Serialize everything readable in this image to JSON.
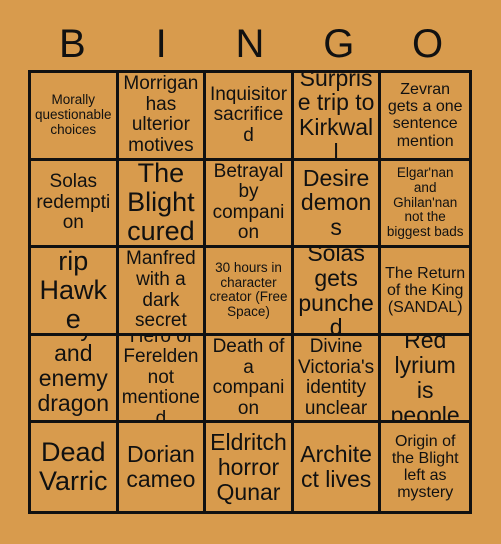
{
  "card": {
    "background_color": "#d89b4d",
    "ink_color": "#111111",
    "header_letters": [
      "B",
      "I",
      "N",
      "G",
      "O"
    ],
    "rows": [
      [
        {
          "text": "Morally questionable choices",
          "size": "xs"
        },
        {
          "text": "Morrigan has ulterior motives",
          "size": "md"
        },
        {
          "text": "Inquisitor sacrificed",
          "size": "md"
        },
        {
          "text": "Surprise trip to Kirkwall",
          "size": "lg"
        },
        {
          "text": "Zevran gets a one sentence mention",
          "size": "sm"
        }
      ],
      [
        {
          "text": "Solas redemption",
          "size": "md"
        },
        {
          "text": "The Blight cured",
          "size": "xl"
        },
        {
          "text": "Betrayal by companion",
          "size": "md"
        },
        {
          "text": "Desire demons",
          "size": "lg"
        },
        {
          "text": "Elgar'nan and Ghilan'nan not the biggest bads",
          "size": "xs"
        }
      ],
      [
        {
          "text": "rip Hawke",
          "size": "xl"
        },
        {
          "text": "Manfred with a dark secret",
          "size": "md"
        },
        {
          "text": "30 hours in character creator (Free Space)",
          "size": "xs"
        },
        {
          "text": "Solas gets punched",
          "size": "lg"
        },
        {
          "text": "The Return of the King (SANDAL)",
          "size": "sm"
        }
      ],
      [
        {
          "text": "Ally and enemy dragons",
          "size": "lg"
        },
        {
          "text": "Hero of Ferelden not mentioned",
          "size": "md"
        },
        {
          "text": "Death of a companion",
          "size": "md"
        },
        {
          "text": "Divine Victoria's identity unclear",
          "size": "md"
        },
        {
          "text": "Red lyrium is people",
          "size": "lg"
        }
      ],
      [
        {
          "text": "Dead Varric",
          "size": "xl"
        },
        {
          "text": "Dorian cameo",
          "size": "lg"
        },
        {
          "text": "Eldritch horror Qunar",
          "size": "lg"
        },
        {
          "text": "Architect lives",
          "size": "lg"
        },
        {
          "text": "Origin of the Blight left as mystery",
          "size": "sm"
        }
      ]
    ]
  }
}
